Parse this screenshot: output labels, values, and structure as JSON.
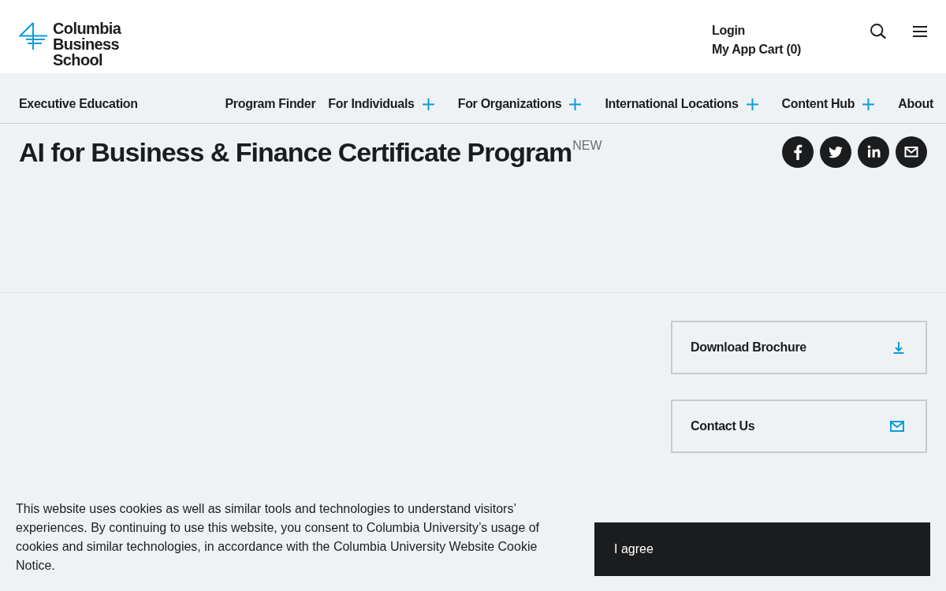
{
  "header": {
    "logo_text": "Columbia Business School",
    "account_links": [
      "Login",
      "My App Cart (0)"
    ]
  },
  "nav": {
    "title": "Executive Education",
    "items": [
      {
        "label": "Program Finder",
        "has_submenu": false
      },
      {
        "label": "For Individuals",
        "has_submenu": true
      },
      {
        "label": "For Organizations",
        "has_submenu": true
      },
      {
        "label": "International Locations",
        "has_submenu": true
      },
      {
        "label": "Content Hub",
        "has_submenu": true
      },
      {
        "label": "About",
        "has_submenu": false
      }
    ]
  },
  "page_title": {
    "text": "AI for Business & Finance Certificate Program",
    "badge": "NEW"
  },
  "share_buttons": [
    {
      "kind": "facebook"
    },
    {
      "kind": "twitter"
    },
    {
      "kind": "linkedin"
    },
    {
      "kind": "email"
    }
  ],
  "actions": [
    {
      "label": "Download Brochure",
      "kind": "download"
    },
    {
      "label": "Contact Us",
      "kind": "contact"
    }
  ],
  "cookie_banner": {
    "message": "This website uses cookies as well as similar tools and technologies to understand visitors’ experiences. By continuing to use this website, you consent to Columbia University’s usage of cookies and similar technologies, in accordance with the Columbia University Website Cookie Notice.",
    "button": "I agree"
  }
}
